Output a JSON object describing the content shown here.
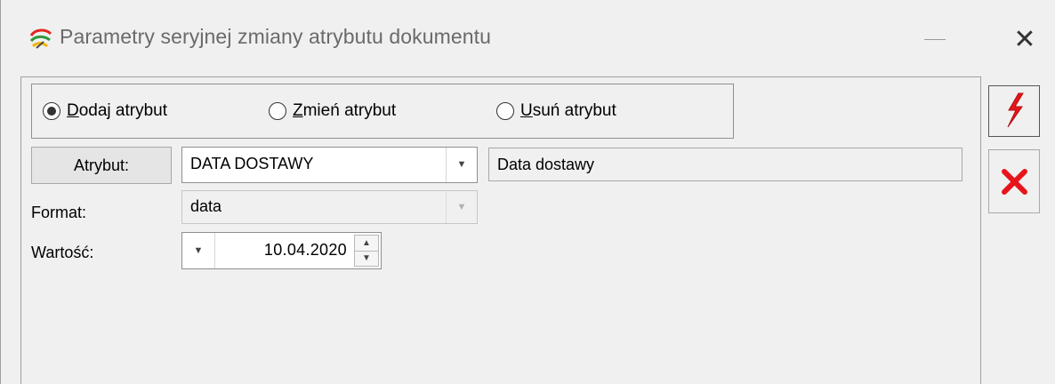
{
  "window": {
    "title": "Parametry seryjnej zmiany atrybutu dokumentu",
    "app_icon": "app-icon",
    "close_glyph": "✕"
  },
  "mode": {
    "options": [
      {
        "prefix": "",
        "hotkey": "D",
        "suffix": "odaj atrybut",
        "checked": true
      },
      {
        "prefix": "",
        "hotkey": "Z",
        "suffix": "mień atrybut",
        "checked": false
      },
      {
        "prefix": "",
        "hotkey": "U",
        "suffix": "suń atrybut",
        "checked": false
      }
    ]
  },
  "form": {
    "attribute_button_label": "Atrybut:",
    "attribute_value": "DATA DOSTAWY",
    "attribute_description": "Data dostawy",
    "format_label": "Format:",
    "format_value": "data",
    "value_label": "Wartość:",
    "date_value": "10.04.2020"
  },
  "actions": {
    "execute_icon": "lightning-icon",
    "cancel_icon": "cancel-x-icon",
    "accent": "#e8141b"
  }
}
